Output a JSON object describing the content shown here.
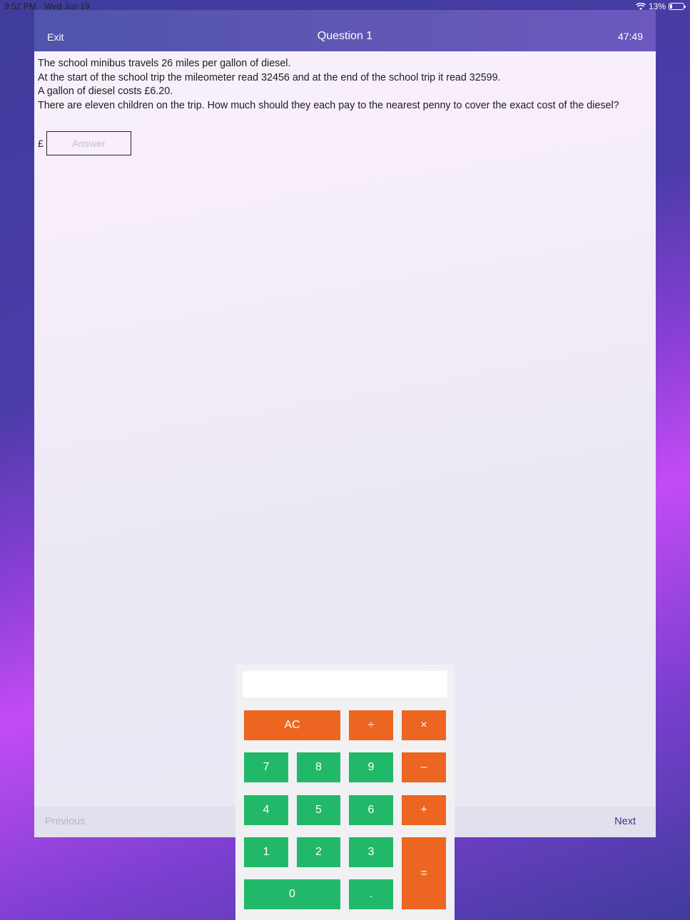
{
  "status_bar": {
    "time": "9:52 PM",
    "date": "Wed Jun 19",
    "battery": "13%"
  },
  "nav": {
    "exit_label": "Exit",
    "title": "Question 1",
    "timer": "47:49"
  },
  "question": {
    "lines": [
      "The school minibus travels 26 miles per gallon of diesel.",
      "At the start of the school trip the mileometer read 32456 and at the end of the school trip it read 32599.",
      "A gallon of diesel costs £6.20.",
      "There are eleven children on the trip. How much should they each pay to the nearest penny to cover the exact cost of the diesel?"
    ]
  },
  "answer": {
    "currency_symbol": "£",
    "placeholder": "Answer",
    "value": ""
  },
  "footer": {
    "previous_label": "Previous",
    "next_label": "Next"
  },
  "calculator": {
    "display": "",
    "keys": {
      "ac": "AC",
      "divide": "÷",
      "multiply": "×",
      "seven": "7",
      "eight": "8",
      "nine": "9",
      "minus": "–",
      "four": "4",
      "five": "5",
      "six": "6",
      "plus": "+",
      "one": "1",
      "two": "2",
      "three": "3",
      "equals": "=",
      "zero": "0",
      "decimal": "."
    }
  },
  "colors": {
    "operator_key": "#ec6521",
    "number_key": "#22b86a",
    "navbar": "#5c56b2",
    "next_link": "#3a3a86"
  }
}
